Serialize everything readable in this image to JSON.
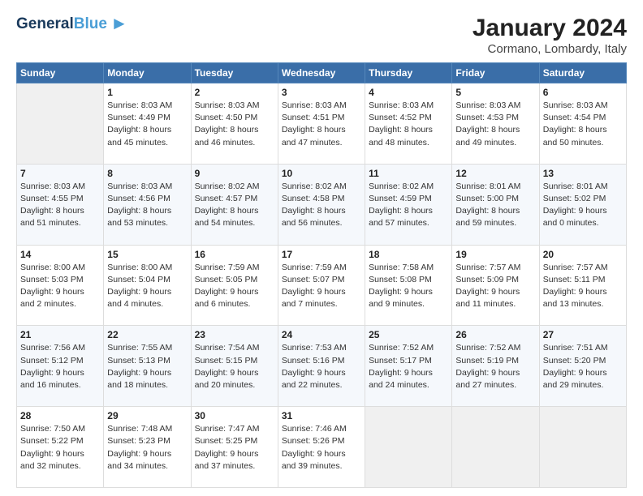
{
  "header": {
    "logo_line1": "General",
    "logo_line2": "Blue",
    "title": "January 2024",
    "subtitle": "Cormano, Lombardy, Italy"
  },
  "days_of_week": [
    "Sunday",
    "Monday",
    "Tuesday",
    "Wednesday",
    "Thursday",
    "Friday",
    "Saturday"
  ],
  "weeks": [
    [
      {
        "num": "",
        "info": ""
      },
      {
        "num": "1",
        "info": "Sunrise: 8:03 AM\nSunset: 4:49 PM\nDaylight: 8 hours\nand 45 minutes."
      },
      {
        "num": "2",
        "info": "Sunrise: 8:03 AM\nSunset: 4:50 PM\nDaylight: 8 hours\nand 46 minutes."
      },
      {
        "num": "3",
        "info": "Sunrise: 8:03 AM\nSunset: 4:51 PM\nDaylight: 8 hours\nand 47 minutes."
      },
      {
        "num": "4",
        "info": "Sunrise: 8:03 AM\nSunset: 4:52 PM\nDaylight: 8 hours\nand 48 minutes."
      },
      {
        "num": "5",
        "info": "Sunrise: 8:03 AM\nSunset: 4:53 PM\nDaylight: 8 hours\nand 49 minutes."
      },
      {
        "num": "6",
        "info": "Sunrise: 8:03 AM\nSunset: 4:54 PM\nDaylight: 8 hours\nand 50 minutes."
      }
    ],
    [
      {
        "num": "7",
        "info": "Sunrise: 8:03 AM\nSunset: 4:55 PM\nDaylight: 8 hours\nand 51 minutes."
      },
      {
        "num": "8",
        "info": "Sunrise: 8:03 AM\nSunset: 4:56 PM\nDaylight: 8 hours\nand 53 minutes."
      },
      {
        "num": "9",
        "info": "Sunrise: 8:02 AM\nSunset: 4:57 PM\nDaylight: 8 hours\nand 54 minutes."
      },
      {
        "num": "10",
        "info": "Sunrise: 8:02 AM\nSunset: 4:58 PM\nDaylight: 8 hours\nand 56 minutes."
      },
      {
        "num": "11",
        "info": "Sunrise: 8:02 AM\nSunset: 4:59 PM\nDaylight: 8 hours\nand 57 minutes."
      },
      {
        "num": "12",
        "info": "Sunrise: 8:01 AM\nSunset: 5:00 PM\nDaylight: 8 hours\nand 59 minutes."
      },
      {
        "num": "13",
        "info": "Sunrise: 8:01 AM\nSunset: 5:02 PM\nDaylight: 9 hours\nand 0 minutes."
      }
    ],
    [
      {
        "num": "14",
        "info": "Sunrise: 8:00 AM\nSunset: 5:03 PM\nDaylight: 9 hours\nand 2 minutes."
      },
      {
        "num": "15",
        "info": "Sunrise: 8:00 AM\nSunset: 5:04 PM\nDaylight: 9 hours\nand 4 minutes."
      },
      {
        "num": "16",
        "info": "Sunrise: 7:59 AM\nSunset: 5:05 PM\nDaylight: 9 hours\nand 6 minutes."
      },
      {
        "num": "17",
        "info": "Sunrise: 7:59 AM\nSunset: 5:07 PM\nDaylight: 9 hours\nand 7 minutes."
      },
      {
        "num": "18",
        "info": "Sunrise: 7:58 AM\nSunset: 5:08 PM\nDaylight: 9 hours\nand 9 minutes."
      },
      {
        "num": "19",
        "info": "Sunrise: 7:57 AM\nSunset: 5:09 PM\nDaylight: 9 hours\nand 11 minutes."
      },
      {
        "num": "20",
        "info": "Sunrise: 7:57 AM\nSunset: 5:11 PM\nDaylight: 9 hours\nand 13 minutes."
      }
    ],
    [
      {
        "num": "21",
        "info": "Sunrise: 7:56 AM\nSunset: 5:12 PM\nDaylight: 9 hours\nand 16 minutes."
      },
      {
        "num": "22",
        "info": "Sunrise: 7:55 AM\nSunset: 5:13 PM\nDaylight: 9 hours\nand 18 minutes."
      },
      {
        "num": "23",
        "info": "Sunrise: 7:54 AM\nSunset: 5:15 PM\nDaylight: 9 hours\nand 20 minutes."
      },
      {
        "num": "24",
        "info": "Sunrise: 7:53 AM\nSunset: 5:16 PM\nDaylight: 9 hours\nand 22 minutes."
      },
      {
        "num": "25",
        "info": "Sunrise: 7:52 AM\nSunset: 5:17 PM\nDaylight: 9 hours\nand 24 minutes."
      },
      {
        "num": "26",
        "info": "Sunrise: 7:52 AM\nSunset: 5:19 PM\nDaylight: 9 hours\nand 27 minutes."
      },
      {
        "num": "27",
        "info": "Sunrise: 7:51 AM\nSunset: 5:20 PM\nDaylight: 9 hours\nand 29 minutes."
      }
    ],
    [
      {
        "num": "28",
        "info": "Sunrise: 7:50 AM\nSunset: 5:22 PM\nDaylight: 9 hours\nand 32 minutes."
      },
      {
        "num": "29",
        "info": "Sunrise: 7:48 AM\nSunset: 5:23 PM\nDaylight: 9 hours\nand 34 minutes."
      },
      {
        "num": "30",
        "info": "Sunrise: 7:47 AM\nSunset: 5:25 PM\nDaylight: 9 hours\nand 37 minutes."
      },
      {
        "num": "31",
        "info": "Sunrise: 7:46 AM\nSunset: 5:26 PM\nDaylight: 9 hours\nand 39 minutes."
      },
      {
        "num": "",
        "info": ""
      },
      {
        "num": "",
        "info": ""
      },
      {
        "num": "",
        "info": ""
      }
    ]
  ]
}
